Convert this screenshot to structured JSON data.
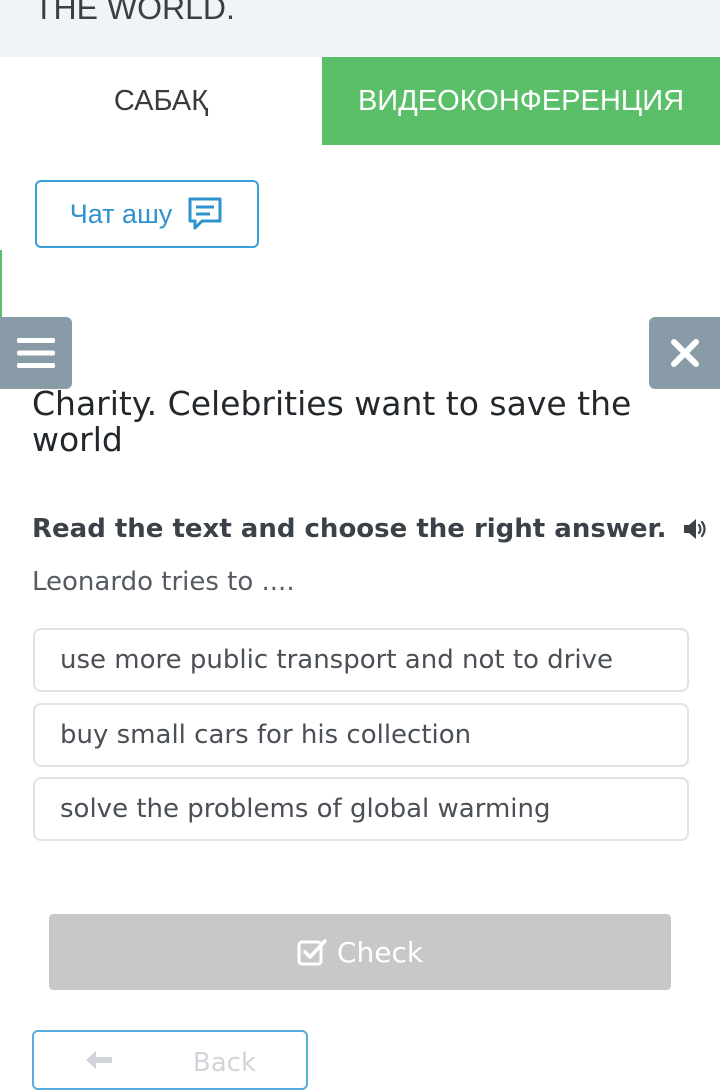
{
  "header": {
    "title": "THE WORLD."
  },
  "tabs": [
    {
      "label": "САБАҚ"
    },
    {
      "label": "ВИДЕОКОНФЕРЕНЦИЯ"
    }
  ],
  "chat": {
    "label": "Чат ашу",
    "icon": "chat-icon"
  },
  "toolbar": {
    "menu_icon": "hamburger-icon",
    "close_icon": "close-icon"
  },
  "lesson": {
    "title": "Charity. Celebrities want to save the world",
    "instruction": "Read the text and choose the right answer.",
    "question": "Leonardo tries to ....",
    "options": [
      "use more public transport and not to drive",
      "buy small cars for his collection",
      "solve the problems of global warming"
    ]
  },
  "actions": {
    "check_label": "Check",
    "back_label": "Back"
  },
  "colors": {
    "accent_green": "#5bbf6a",
    "accent_blue": "#3aa0d8",
    "icon_button_gray": "#8a9ba8",
    "disabled_gray": "#c8c8c8"
  }
}
